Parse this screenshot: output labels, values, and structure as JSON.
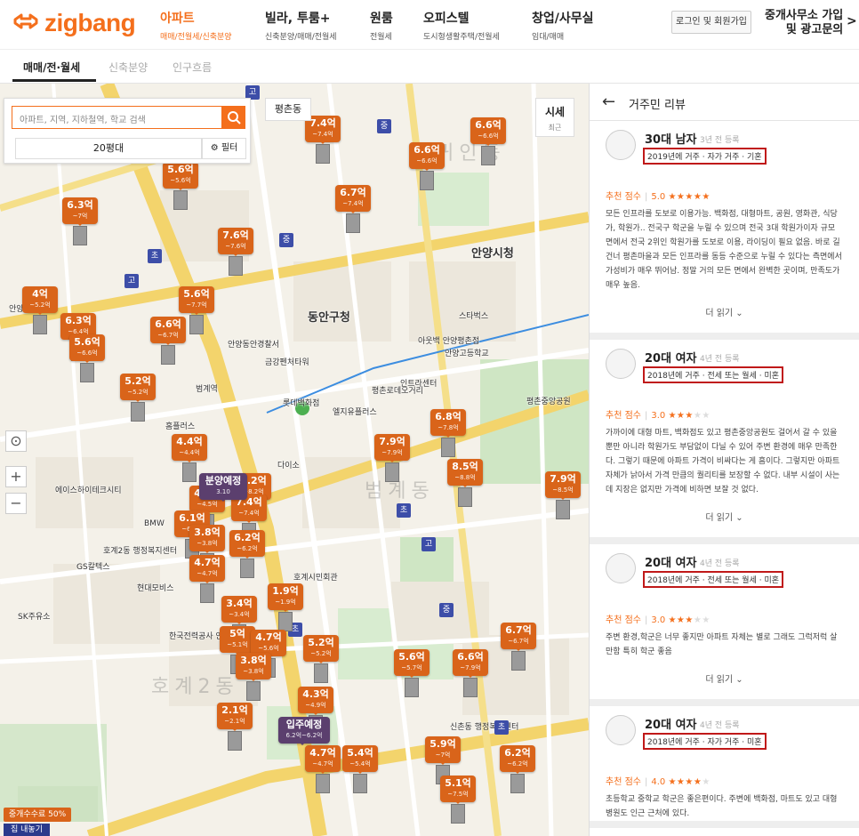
{
  "header": {
    "logo_text": "zigbang",
    "nav": [
      {
        "title": "아파트",
        "sub": "매매/전월세/신축분양",
        "active": true
      },
      {
        "title": "빌라, 투룸+",
        "sub": "신축분양/매매/전월세",
        "active": false
      },
      {
        "title": "원룸",
        "sub": "전월세",
        "active": false
      },
      {
        "title": "오피스텔",
        "sub": "도시형생활주택/전월세",
        "active": false
      },
      {
        "title": "창업/사무실",
        "sub": "임대/매매",
        "active": false
      }
    ],
    "login": "로그인 및 회원가입",
    "broker_line1": "중개사무소 가입",
    "broker_line2": "및 광고문의",
    "broker_arrow": ">"
  },
  "subnav": {
    "tabs": [
      "매매/전·월세",
      "신축분양",
      "인구흐름"
    ]
  },
  "search": {
    "placeholder": "아파트, 지역, 지하철역, 학교 검색",
    "size": "20평대",
    "filter": "필터"
  },
  "map": {
    "dong_chip": "평촌동",
    "price_chip": {
      "label": "시세",
      "sub": "최근"
    },
    "zoom_in": "+",
    "zoom_out": "−",
    "locate": "⊙",
    "fee_badge": "중개수수료 50%",
    "house_btn": "집 내놓기",
    "area_labels": [
      "범계동",
      "호계2동",
      "귀인동"
    ],
    "places": [
      "안양시청",
      "동안구청",
      "평촌로데오거리",
      "호계시민회관",
      "롯데백화점",
      "다이소",
      "현대모비스",
      "한국전력공사 안양지사",
      "범계역",
      "안양고등학교",
      "평촌중앙공원",
      "홈플러스",
      "스타벅스",
      "아웃백 안양평촌점",
      "금강펜처타워",
      "GS칼텍스",
      "SK주유소",
      "BMW",
      "엘지유플러스",
      "안양동안경찰서",
      "호계2동 행정복지센터",
      "신촌동 행정복지센터",
      "안양외고",
      "에이스하이테크시티",
      "인트라센터"
    ],
    "markers": [
      {
        "v": "7.4억",
        "d": "~7.4억"
      },
      {
        "v": "6.6억",
        "d": "~6.6억"
      },
      {
        "v": "6.6억",
        "d": "~6.6억"
      },
      {
        "v": "5.6억",
        "d": "~5.6억"
      },
      {
        "v": "6.7억",
        "d": "~7.4억"
      },
      {
        "v": "6.3억",
        "d": "~7억"
      },
      {
        "v": "7.6억",
        "d": "~7.6억"
      },
      {
        "v": "4억",
        "d": "~5.2억"
      },
      {
        "v": "5.6억",
        "d": "~7.7억"
      },
      {
        "v": "6.3억",
        "d": "~6.4억"
      },
      {
        "v": "6.6억",
        "d": "~6.7억"
      },
      {
        "v": "5.6억",
        "d": "~6.6억"
      },
      {
        "v": "5.2억",
        "d": "~5.2억"
      },
      {
        "v": "6.8억",
        "d": "~7.8억"
      },
      {
        "v": "7.9억",
        "d": "~7.9억"
      },
      {
        "v": "4.4억",
        "d": "~4.4억"
      },
      {
        "v": "8.5억",
        "d": "~8.8억"
      },
      {
        "v": "7.9억",
        "d": "~8.5억"
      },
      {
        "v": "8.2억",
        "d": "~8.2억"
      },
      {
        "v": "4.5억",
        "d": "~4.5억"
      },
      {
        "v": "7.4억",
        "d": "~7.4억"
      },
      {
        "v": "6.1억",
        "d": "~6.1억"
      },
      {
        "v": "3.8억",
        "d": "~3.8억"
      },
      {
        "v": "6.2억",
        "d": "~6.2억"
      },
      {
        "v": "4.7억",
        "d": "~4.7억"
      },
      {
        "v": "1.9억",
        "d": "~1.9억"
      },
      {
        "v": "3.4억",
        "d": "~3.4억"
      },
      {
        "v": "5억",
        "d": "~5.1억"
      },
      {
        "v": "4.7억",
        "d": "~5.6억"
      },
      {
        "v": "5.2억",
        "d": "~5.2억"
      },
      {
        "v": "3.8억",
        "d": "~3.8억"
      },
      {
        "v": "6.7억",
        "d": "~6.7억"
      },
      {
        "v": "5.6억",
        "d": "~5.7억"
      },
      {
        "v": "6.6억",
        "d": "~7.9억"
      },
      {
        "v": "4.3억",
        "d": "~4.9억"
      },
      {
        "v": "2.1억",
        "d": "~2.1억"
      },
      {
        "v": "5.9억",
        "d": "~7억"
      },
      {
        "v": "4.7억",
        "d": "~4.7억"
      },
      {
        "v": "5.4억",
        "d": "~5.4억"
      },
      {
        "v": "6.2억",
        "d": "~6.2억"
      },
      {
        "v": "5.1억",
        "d": "~7.5억"
      }
    ],
    "special_markers": [
      {
        "v": "분양예정",
        "d": "3.10"
      },
      {
        "v": "입주예정",
        "d": "6.2억~6.2억"
      }
    ]
  },
  "panel": {
    "back": "←",
    "title": "거주민 리뷰",
    "more_label": "더 읽기 ⌄",
    "score_label": "추천 점수",
    "reviews": [
      {
        "name": "30대 남자",
        "when": "3년 전 등록",
        "meta": "2019년에 거주 · 자가 거주 · 기혼",
        "score": "5.0",
        "stars_on": "★★★★★",
        "stars_off": "",
        "body": "모든 인프라를 도보로 이용가능. 백화점, 대형마트, 공원, 영화관, 식당가, 학원가.. 전국구 학군을 누릴 수 있으며 전국 3대 학원가이자 규모 면에서 전국 2위인 학원가를 도보로 이용, 라이딩이 필요 없음. 바로 길 건너 평촌마을과 모든 인프라를 동등 수준으로 누릴 수 있다는 측면에서 가성비가 매우 뛰어남. 정말 거의 모든 면에서 완벽한 곳이며, 만족도가 매우 높음."
      },
      {
        "name": "20대 여자",
        "when": "4년 전 등록",
        "meta": "2018년에 거주 · 전세 또는 월세 · 미혼",
        "score": "3.0",
        "stars_on": "★★★",
        "stars_off": "★★",
        "body": "가까이에 대형 마트, 백화점도 있고 평촌중앙공원도 걸어서 갈 수 있을 뿐만 아니라 학원가도 부담없이 다닐 수 있어 주변 환경에 매우 만족한다. 그렇기 때문에 아파트 가격이 비싸다는 게 흠이다. 그렇지만 아파트 자체가 낡아서 가격 만큼의 퀄리티를 보장할 수 없다. 내부 시설이 사는 데 지장은 없지만 가격에 비하면 보잘 것 없다."
      },
      {
        "name": "20대 여자",
        "when": "4년 전 등록",
        "meta": "2018년에 거주 · 전세 또는 월세 · 미혼",
        "score": "3.0",
        "stars_on": "★★★",
        "stars_off": "★★",
        "body": "주변 환경,학군은 너무 좋지만 아파트 자체는 별로 그래도 그럭저럭 살만함 특히 학군 좋음"
      },
      {
        "name": "20대 여자",
        "when": "4년 전 등록",
        "meta": "2018년에 거주 · 자가 거주 · 미혼",
        "score": "4.0",
        "stars_on": "★★★★",
        "stars_off": "★",
        "body": "초등학교 중학교 학군은 좋은편이다. 주변에 백화점, 마트도 있고 대형병원도 인근 근처에 있다."
      }
    ]
  },
  "colors": {
    "brand": "#f46f1c",
    "marker": "#d9641a",
    "highlight": "#c01919"
  }
}
